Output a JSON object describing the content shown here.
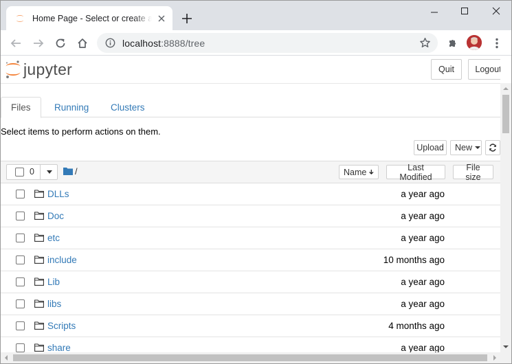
{
  "browser": {
    "tab_title": "Home Page - Select or create a n",
    "url_host": "localhost",
    "url_port_path": ":8888/tree"
  },
  "header": {
    "logo_text": "jupyter",
    "quit_label": "Quit",
    "logout_label": "Logout"
  },
  "tabs": [
    {
      "label": "Files",
      "active": true
    },
    {
      "label": "Running",
      "active": false
    },
    {
      "label": "Clusters",
      "active": false
    }
  ],
  "hint": "Select items to perform actions on them.",
  "actions": {
    "upload_label": "Upload",
    "new_label": "New"
  },
  "list_header": {
    "selected_count": "0",
    "path": "/",
    "name_label": "Name",
    "modified_label": "Last Modified",
    "size_label": "File size"
  },
  "files": [
    {
      "name": "DLLs",
      "modified": "a year ago"
    },
    {
      "name": "Doc",
      "modified": "a year ago"
    },
    {
      "name": "etc",
      "modified": "a year ago"
    },
    {
      "name": "include",
      "modified": "10 months ago"
    },
    {
      "name": "Lib",
      "modified": "a year ago"
    },
    {
      "name": "libs",
      "modified": "a year ago"
    },
    {
      "name": "Scripts",
      "modified": "4 months ago"
    },
    {
      "name": "share",
      "modified": "a year ago"
    }
  ],
  "colors": {
    "link": "#337ab7",
    "jupyter_orange": "#f37726",
    "tabstrip": "#dee1e6"
  }
}
